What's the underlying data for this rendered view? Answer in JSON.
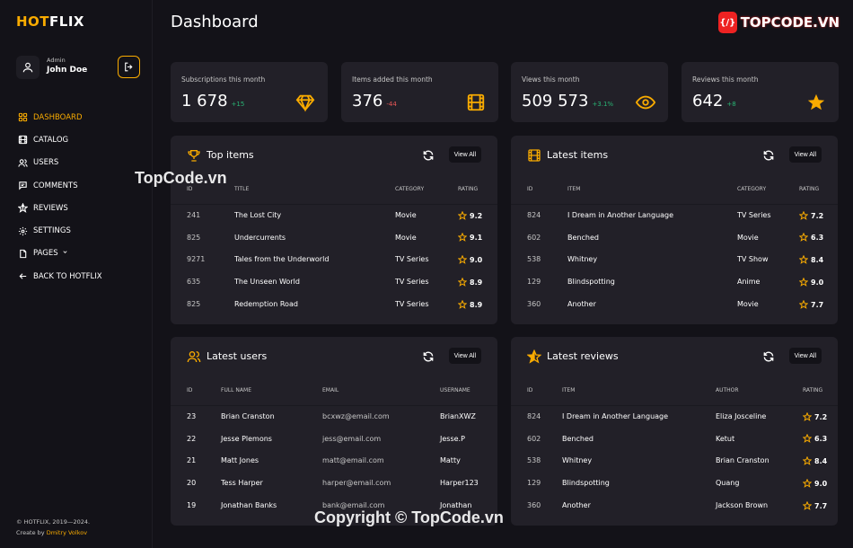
{
  "sidebar": {
    "logo_hot": "HOT",
    "logo_flix": "FLIX",
    "user_role": "Admin",
    "user_name": "John Doe",
    "items": [
      {
        "label": "DASHBOARD",
        "icon": "grid-icon",
        "active": true
      },
      {
        "label": "CATALOG",
        "icon": "film-icon"
      },
      {
        "label": "USERS",
        "icon": "users-icon"
      },
      {
        "label": "COMMENTS",
        "icon": "comment-icon"
      },
      {
        "label": "REVIEWS",
        "icon": "star-half-icon"
      },
      {
        "label": "SETTINGS",
        "icon": "gear-icon"
      },
      {
        "label": "PAGES",
        "icon": "pages-icon"
      },
      {
        "label": "BACK TO HOTFLIX",
        "icon": "arrow-left-icon"
      }
    ],
    "copyright": "© HOTFLIX, 2019—2024.",
    "created_by": "Create by",
    "author": "Dmitry Volkov"
  },
  "header": {
    "title": "Dashboard",
    "brand_badge": "{/}",
    "brand_text": "TOPCODE.VN"
  },
  "stats": [
    {
      "label": "Subscriptions this month",
      "value": "1 678",
      "delta": "+15",
      "trend": "up",
      "icon": "diamond-icon"
    },
    {
      "label": "Items added this month",
      "value": "376",
      "delta": "-44",
      "trend": "down",
      "icon": "film-icon"
    },
    {
      "label": "Views this month",
      "value": "509 573",
      "delta": "+3.1%",
      "trend": "up",
      "icon": "eye-icon"
    },
    {
      "label": "Reviews this month",
      "value": "642",
      "delta": "+8",
      "trend": "up",
      "icon": "star-icon"
    }
  ],
  "view_all_label": "View All",
  "top_items": {
    "title": "Top items",
    "columns": [
      "ID",
      "TITLE",
      "CATEGORY",
      "RATING"
    ],
    "rows": [
      [
        "241",
        "The Lost City",
        "Movie",
        "9.2"
      ],
      [
        "825",
        "Undercurrents",
        "Movie",
        "9.1"
      ],
      [
        "9271",
        "Tales from the Underworld",
        "TV Series",
        "9.0"
      ],
      [
        "635",
        "The Unseen World",
        "TV Series",
        "8.9"
      ],
      [
        "825",
        "Redemption Road",
        "TV Series",
        "8.9"
      ]
    ]
  },
  "latest_items": {
    "title": "Latest items",
    "columns": [
      "ID",
      "ITEM",
      "CATEGORY",
      "RATING"
    ],
    "rows": [
      [
        "824",
        "I Dream in Another Language",
        "TV Series",
        "7.2"
      ],
      [
        "602",
        "Benched",
        "Movie",
        "6.3"
      ],
      [
        "538",
        "Whitney",
        "TV Show",
        "8.4"
      ],
      [
        "129",
        "Blindspotting",
        "Anime",
        "9.0"
      ],
      [
        "360",
        "Another",
        "Movie",
        "7.7"
      ]
    ]
  },
  "latest_users": {
    "title": "Latest users",
    "columns": [
      "ID",
      "FULL NAME",
      "EMAIL",
      "USERNAME"
    ],
    "rows": [
      [
        "23",
        "Brian Cranston",
        "bcxwz@email.com",
        "BrianXWZ"
      ],
      [
        "22",
        "Jesse Plemons",
        "jess@email.com",
        "Jesse.P"
      ],
      [
        "21",
        "Matt Jones",
        "matt@email.com",
        "Matty"
      ],
      [
        "20",
        "Tess Harper",
        "harper@email.com",
        "Harper123"
      ],
      [
        "19",
        "Jonathan Banks",
        "bank@email.com",
        "Jonathan"
      ]
    ]
  },
  "latest_reviews": {
    "title": "Latest reviews",
    "columns": [
      "ID",
      "ITEM",
      "AUTHOR",
      "RATING"
    ],
    "rows": [
      [
        "824",
        "I Dream in Another Language",
        "Eliza Josceline",
        "7.2"
      ],
      [
        "602",
        "Benched",
        "Ketut",
        "6.3"
      ],
      [
        "538",
        "Whitney",
        "Brian Cranston",
        "8.4"
      ],
      [
        "129",
        "Blindspotting",
        "Quang",
        "9.0"
      ],
      [
        "360",
        "Another",
        "Jackson Brown",
        "7.7"
      ]
    ]
  },
  "colors": {
    "accent": "#f9ab00",
    "up": "#29b474",
    "down": "#eb5757",
    "card": "#222028",
    "bg": "#131218"
  },
  "watermarks": [
    "TopCode.vn",
    "Copyright © TopCode.vn"
  ]
}
